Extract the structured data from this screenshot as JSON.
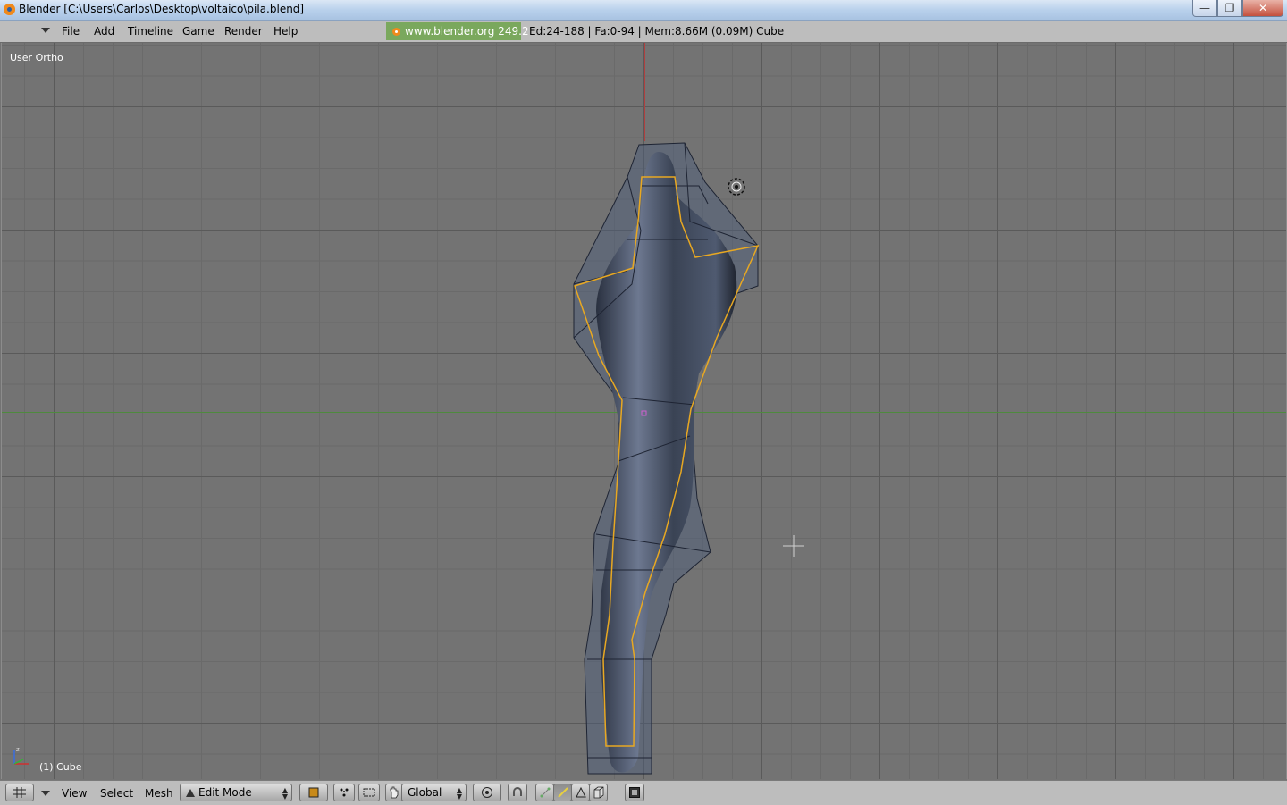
{
  "window": {
    "title": "Blender [C:\\Users\\Carlos\\Desktop\\voltaico\\pila.blend]",
    "minimize_glyph": "—",
    "maximize_glyph": "❐",
    "close_glyph": "✕"
  },
  "info_bar": {
    "menus": [
      "File",
      "Add",
      "Timeline",
      "Game",
      "Render",
      "Help"
    ],
    "website": "www.blender.org 249.2",
    "stats": "Ed:24-188 | Fa:0-94 | Mem:8.66M (0.09M) Cube"
  },
  "viewport": {
    "view_name": "User Ortho",
    "object_label": "(1) Cube",
    "axis_colors": {
      "x": "#4e8a3e",
      "y": "#b04040"
    },
    "selection_color": "#e8a822",
    "mesh_color": "#4a5568"
  },
  "bottom_bar": {
    "menus": [
      "View",
      "Select",
      "Mesh"
    ],
    "mode": "Edit Mode",
    "orientation": "Global",
    "icons": [
      "grid-icon",
      "draw-type-icon",
      "pivot-icon",
      "manipulator-icon",
      "hand-icon",
      "proportional-edit-icon",
      "snap-icon",
      "vertex-select-icon",
      "edge-select-icon",
      "face-select-icon",
      "occlude-icon",
      "render-icon"
    ]
  }
}
